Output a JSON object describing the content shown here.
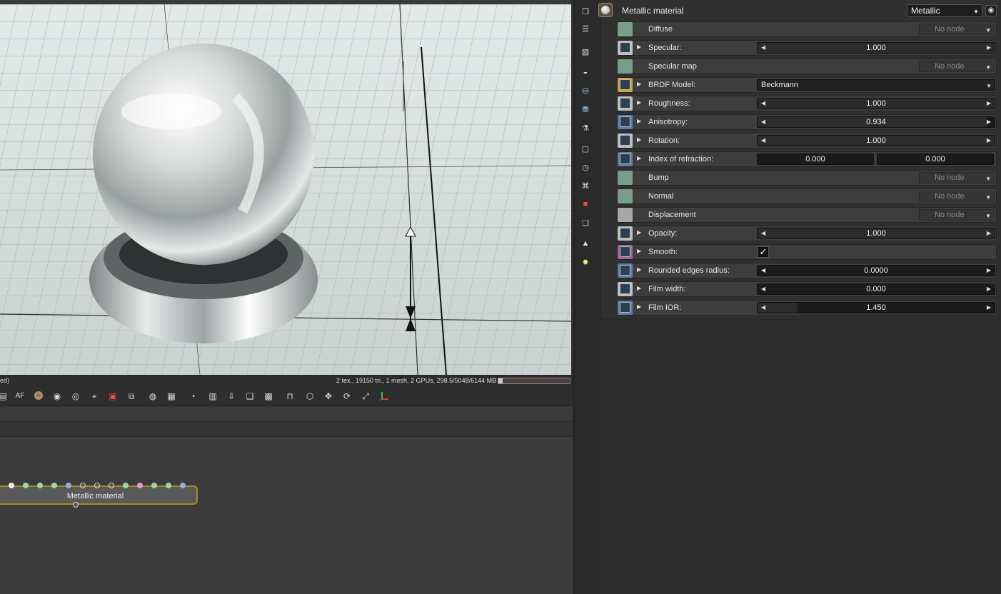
{
  "statusbar": {
    "left_text": "ed)",
    "info": "2 tex., 19150 tri., 1 mesh, 2 GPUs, 298.5/5048/6144 MB"
  },
  "toolbar": {
    "icons": [
      "list-icon",
      "af-icon",
      "color-wheel-icon",
      "material-ball-icon",
      "material-pick-icon",
      "pick-icon",
      "region-icon",
      "export-icon",
      "camera-icon",
      "grid-icon",
      "speedometer-icon",
      "clipboard-icon",
      "download-icon",
      "layers-icon",
      "checker-icon",
      "lock-icon",
      "cube-icon",
      "move-icon",
      "rotate-icon",
      "fullscreen-icon",
      "axis-icon"
    ]
  },
  "viewport": {
    "scene": "render-preview"
  },
  "nodegraph": {
    "node_label": "Metallic material"
  },
  "inspector": {
    "material_name": "Metallic material",
    "material_type": "Metallic",
    "rows": [
      {
        "label": "Diffuse",
        "kind": "node",
        "value": "No node",
        "pin_color": "#7a9e8c"
      },
      {
        "label": "Specular:",
        "kind": "slider",
        "value": "1.000",
        "fraction": 1.0,
        "pin_color": "#bfbfbf"
      },
      {
        "label": "Specular map",
        "kind": "node",
        "value": "No node",
        "pin_color": "#7a9e8c"
      },
      {
        "label": "BRDF Model:",
        "kind": "dropdown",
        "value": "Beckmann",
        "pin_color": "#c8a43a"
      },
      {
        "label": "Roughness:",
        "kind": "slider",
        "value": "1.000",
        "fraction": 1.0,
        "pin_color": "#bfbfbf"
      },
      {
        "label": "Anisotropy:",
        "kind": "slider",
        "value": "0.934",
        "fraction": 0.967,
        "pin_color": "#5a7fa8"
      },
      {
        "label": "Rotation:",
        "kind": "slider",
        "value": "1.000",
        "fraction": 1.0,
        "pin_color": "#bfbfbf"
      },
      {
        "label": "Index of refraction:",
        "kind": "pair",
        "value": "0.000",
        "value2": "0.000",
        "pin_color": "#5a7fa8"
      },
      {
        "label": "Bump",
        "kind": "node",
        "value": "No node",
        "pin_color": "#7a9e8c"
      },
      {
        "label": "Normal",
        "kind": "node",
        "value": "No node",
        "pin_color": "#7a9e8c"
      },
      {
        "label": "Displacement",
        "kind": "node",
        "value": "No node",
        "pin_color": "#a8a8a8"
      },
      {
        "label": "Opacity:",
        "kind": "slider",
        "value": "1.000",
        "fraction": 1.0,
        "pin_color": "#bfbfbf"
      },
      {
        "label": "Smooth:",
        "kind": "check",
        "value": "✓",
        "pin_color": "#a066a0"
      },
      {
        "label": "Rounded edges radius:",
        "kind": "slider",
        "value": "0.0000",
        "fraction": 0.0,
        "pin_color": "#5a7fa8"
      },
      {
        "label": "Film width:",
        "kind": "slider",
        "value": "0.000",
        "fraction": 0.0,
        "pin_color": "#bfbfbf"
      },
      {
        "label": "Film IOR:",
        "kind": "slider",
        "value": "1.450",
        "fraction": 0.17,
        "pin_color": "#5a7fa8"
      }
    ]
  },
  "sidebar": {
    "icons": [
      "layers-icon",
      "outliner-icon",
      "image-icon",
      "camera-settings-icon",
      "database-icon",
      "database-alt-icon",
      "paint-icon",
      "frame-icon",
      "clock-icon",
      "script-icon",
      "cube-red-icon",
      "stack-icon",
      "picture-icon",
      "sun-icon"
    ]
  }
}
